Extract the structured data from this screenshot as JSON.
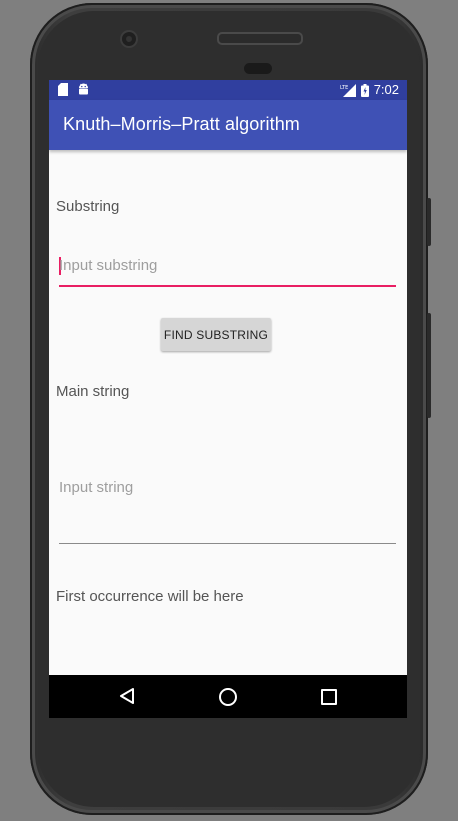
{
  "status_bar": {
    "time": "7:02",
    "left_icons": [
      "sd-card-icon",
      "android-icon"
    ],
    "right_icons": [
      "lte-signal-icon",
      "battery-icon"
    ]
  },
  "app_bar": {
    "title": "Knuth–Morris–Pratt algorithm"
  },
  "substring": {
    "label": "Substring",
    "placeholder": "Input substring",
    "value": ""
  },
  "find_button": {
    "label": "FIND SUBSTRING"
  },
  "main_string": {
    "label": "Main string",
    "placeholder": "Input string",
    "value": ""
  },
  "result": {
    "text": "First occurrence will be here"
  },
  "nav_bar": {
    "buttons": [
      "back",
      "home",
      "recents"
    ]
  },
  "colors": {
    "primary": "#3f51b5",
    "primary_dark": "#303f9f",
    "accent": "#e91e63",
    "background": "#fafafa"
  }
}
